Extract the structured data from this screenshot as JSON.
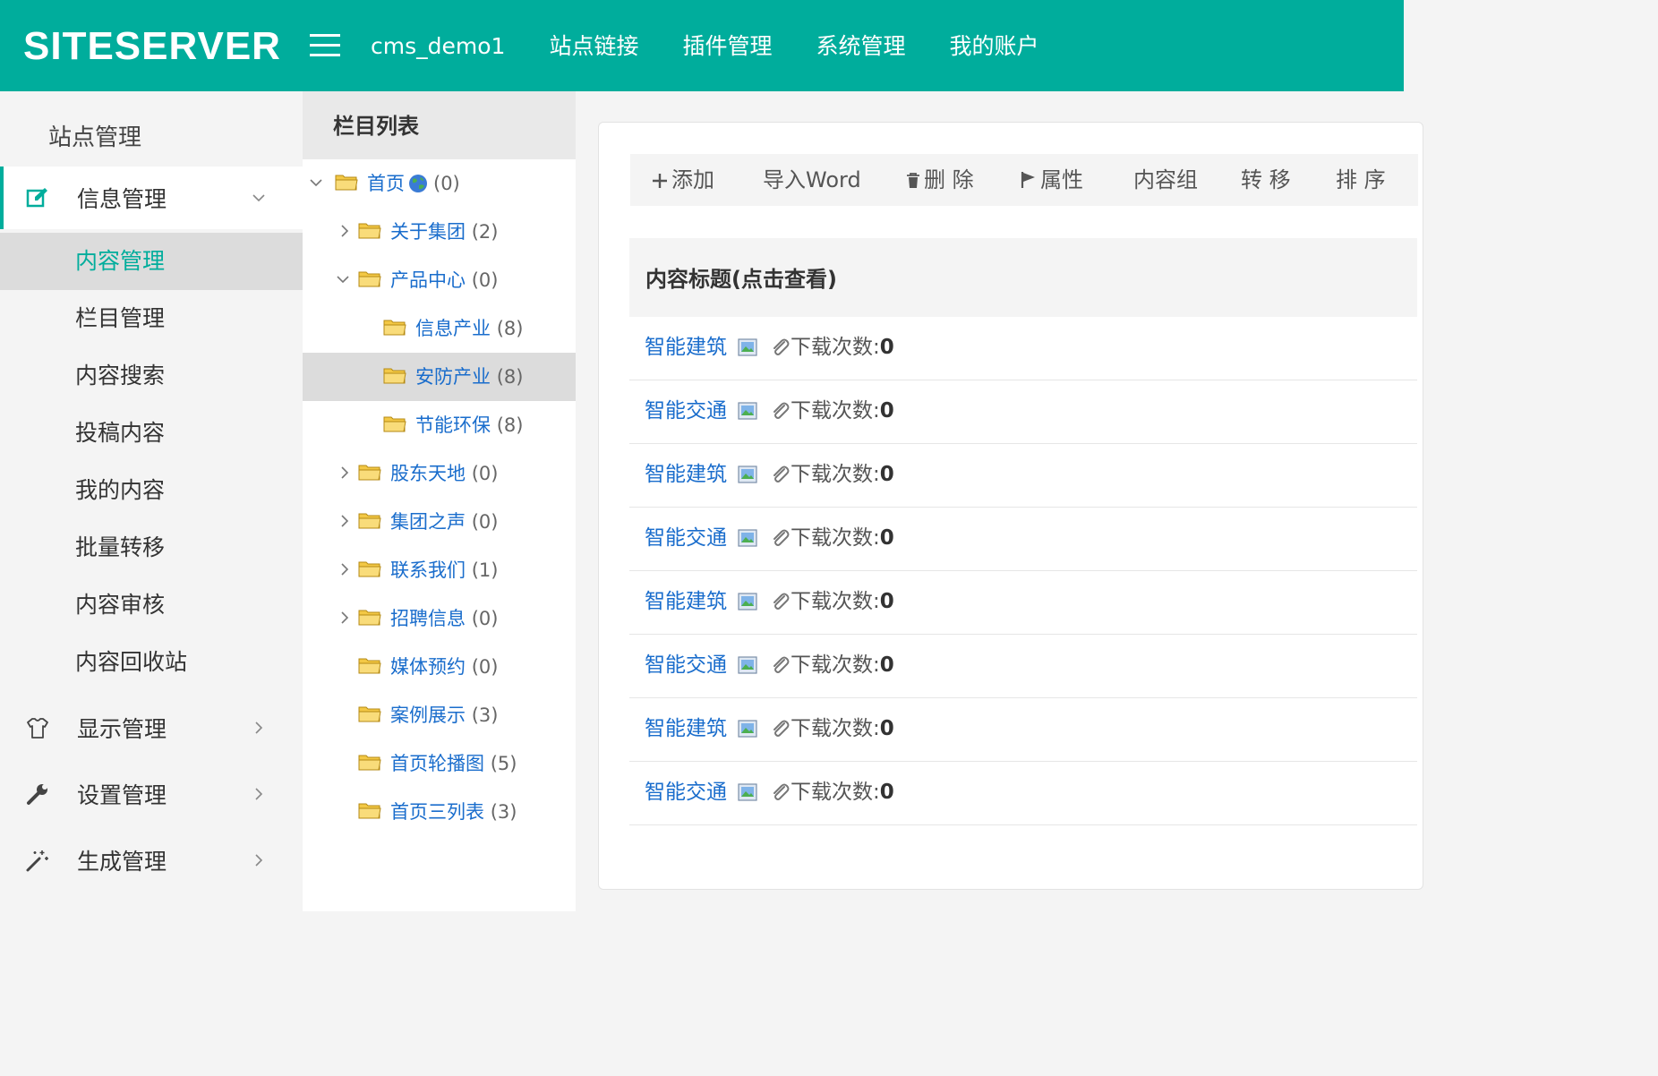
{
  "header": {
    "logo": "SITESERVER",
    "nav": [
      "cms_demo1",
      "站点链接",
      "插件管理",
      "系统管理",
      "我的账户"
    ]
  },
  "sidebar": {
    "title": "站点管理",
    "groups": [
      {
        "label": "信息管理",
        "icon": "edit-icon",
        "expanded": true
      },
      {
        "label": "显示管理",
        "icon": "shirt-icon",
        "expanded": false
      },
      {
        "label": "设置管理",
        "icon": "wrench-icon",
        "expanded": false
      },
      {
        "label": "生成管理",
        "icon": "magic-wand-icon",
        "expanded": false
      }
    ],
    "subitems": [
      "内容管理",
      "栏目管理",
      "内容搜索",
      "投稿内容",
      "我的内容",
      "批量转移",
      "内容审核",
      "内容回收站"
    ],
    "active_subitem": "内容管理"
  },
  "tree": {
    "title": "栏目列表",
    "nodes": [
      {
        "label": "首页",
        "count": "(0)",
        "toggle": "open",
        "level": 0,
        "globe": true
      },
      {
        "label": "关于集团",
        "count": "(2)",
        "toggle": "closed",
        "level": 1
      },
      {
        "label": "产品中心",
        "count": "(0)",
        "toggle": "open",
        "level": 1
      },
      {
        "label": "信息产业",
        "count": "(8)",
        "toggle": "none",
        "level": 2
      },
      {
        "label": "安防产业",
        "count": "(8)",
        "toggle": "none",
        "level": 2,
        "selected": true
      },
      {
        "label": "节能环保",
        "count": "(8)",
        "toggle": "none",
        "level": 2
      },
      {
        "label": "股东天地",
        "count": "(0)",
        "toggle": "closed",
        "level": 1
      },
      {
        "label": "集团之声",
        "count": "(0)",
        "toggle": "closed",
        "level": 1
      },
      {
        "label": "联系我们",
        "count": "(1)",
        "toggle": "closed",
        "level": 1
      },
      {
        "label": "招聘信息",
        "count": "(0)",
        "toggle": "closed",
        "level": 1
      },
      {
        "label": "媒体预约",
        "count": "(0)",
        "toggle": "none",
        "level": 1
      },
      {
        "label": "案例展示",
        "count": "(3)",
        "toggle": "none",
        "level": 1
      },
      {
        "label": "首页轮播图",
        "count": "(5)",
        "toggle": "none",
        "level": 1
      },
      {
        "label": "首页三列表",
        "count": "(3)",
        "toggle": "none",
        "level": 1
      }
    ]
  },
  "toolbar": {
    "buttons": [
      {
        "label": "添加",
        "icon": "plus-icon"
      },
      {
        "label": "导入Word",
        "icon": ""
      },
      {
        "label": "删 除",
        "icon": "trash-icon"
      },
      {
        "label": "属性",
        "icon": "flag-icon"
      },
      {
        "label": "内容组",
        "icon": ""
      },
      {
        "label": "转 移",
        "icon": ""
      },
      {
        "label": "排 序",
        "icon": ""
      }
    ]
  },
  "content": {
    "header": "内容标题(点击查看)",
    "download_label": "下载次数:",
    "rows": [
      {
        "title": "智能建筑",
        "downloads": "0"
      },
      {
        "title": "智能交通",
        "downloads": "0"
      },
      {
        "title": "智能建筑",
        "downloads": "0"
      },
      {
        "title": "智能交通",
        "downloads": "0"
      },
      {
        "title": "智能建筑",
        "downloads": "0"
      },
      {
        "title": "智能交通",
        "downloads": "0"
      },
      {
        "title": "智能建筑",
        "downloads": "0"
      },
      {
        "title": "智能交通",
        "downloads": "0"
      }
    ]
  },
  "colors": {
    "brand": "#00ad9c",
    "link": "#1a6dcc",
    "folder": "#f3c845"
  }
}
